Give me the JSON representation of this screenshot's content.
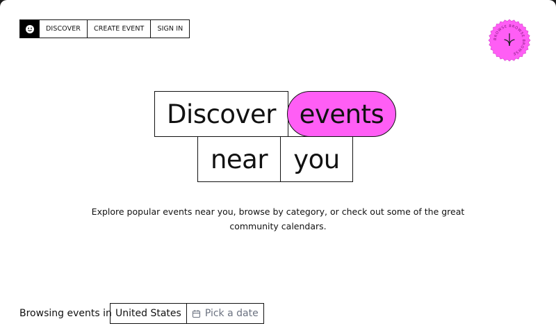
{
  "nav": {
    "items": [
      {
        "label": "DISCOVER"
      },
      {
        "label": "CREATE EVENT"
      },
      {
        "label": "SIGN IN"
      }
    ]
  },
  "badge": {
    "ring_text": "BROWSE BROWSE BROWSE ",
    "color": "#ff5ef5"
  },
  "hero": {
    "word1": "Discover",
    "word2": "events",
    "word3": "near",
    "word4": "you",
    "accent": "#ff5ef5"
  },
  "subtitle": {
    "line1": "Explore popular events near you, browse by category, or check out some of the great",
    "line2": "community calendars."
  },
  "browse": {
    "label": "Browsing events in",
    "country": "United States",
    "date_placeholder": "Pick a date"
  }
}
